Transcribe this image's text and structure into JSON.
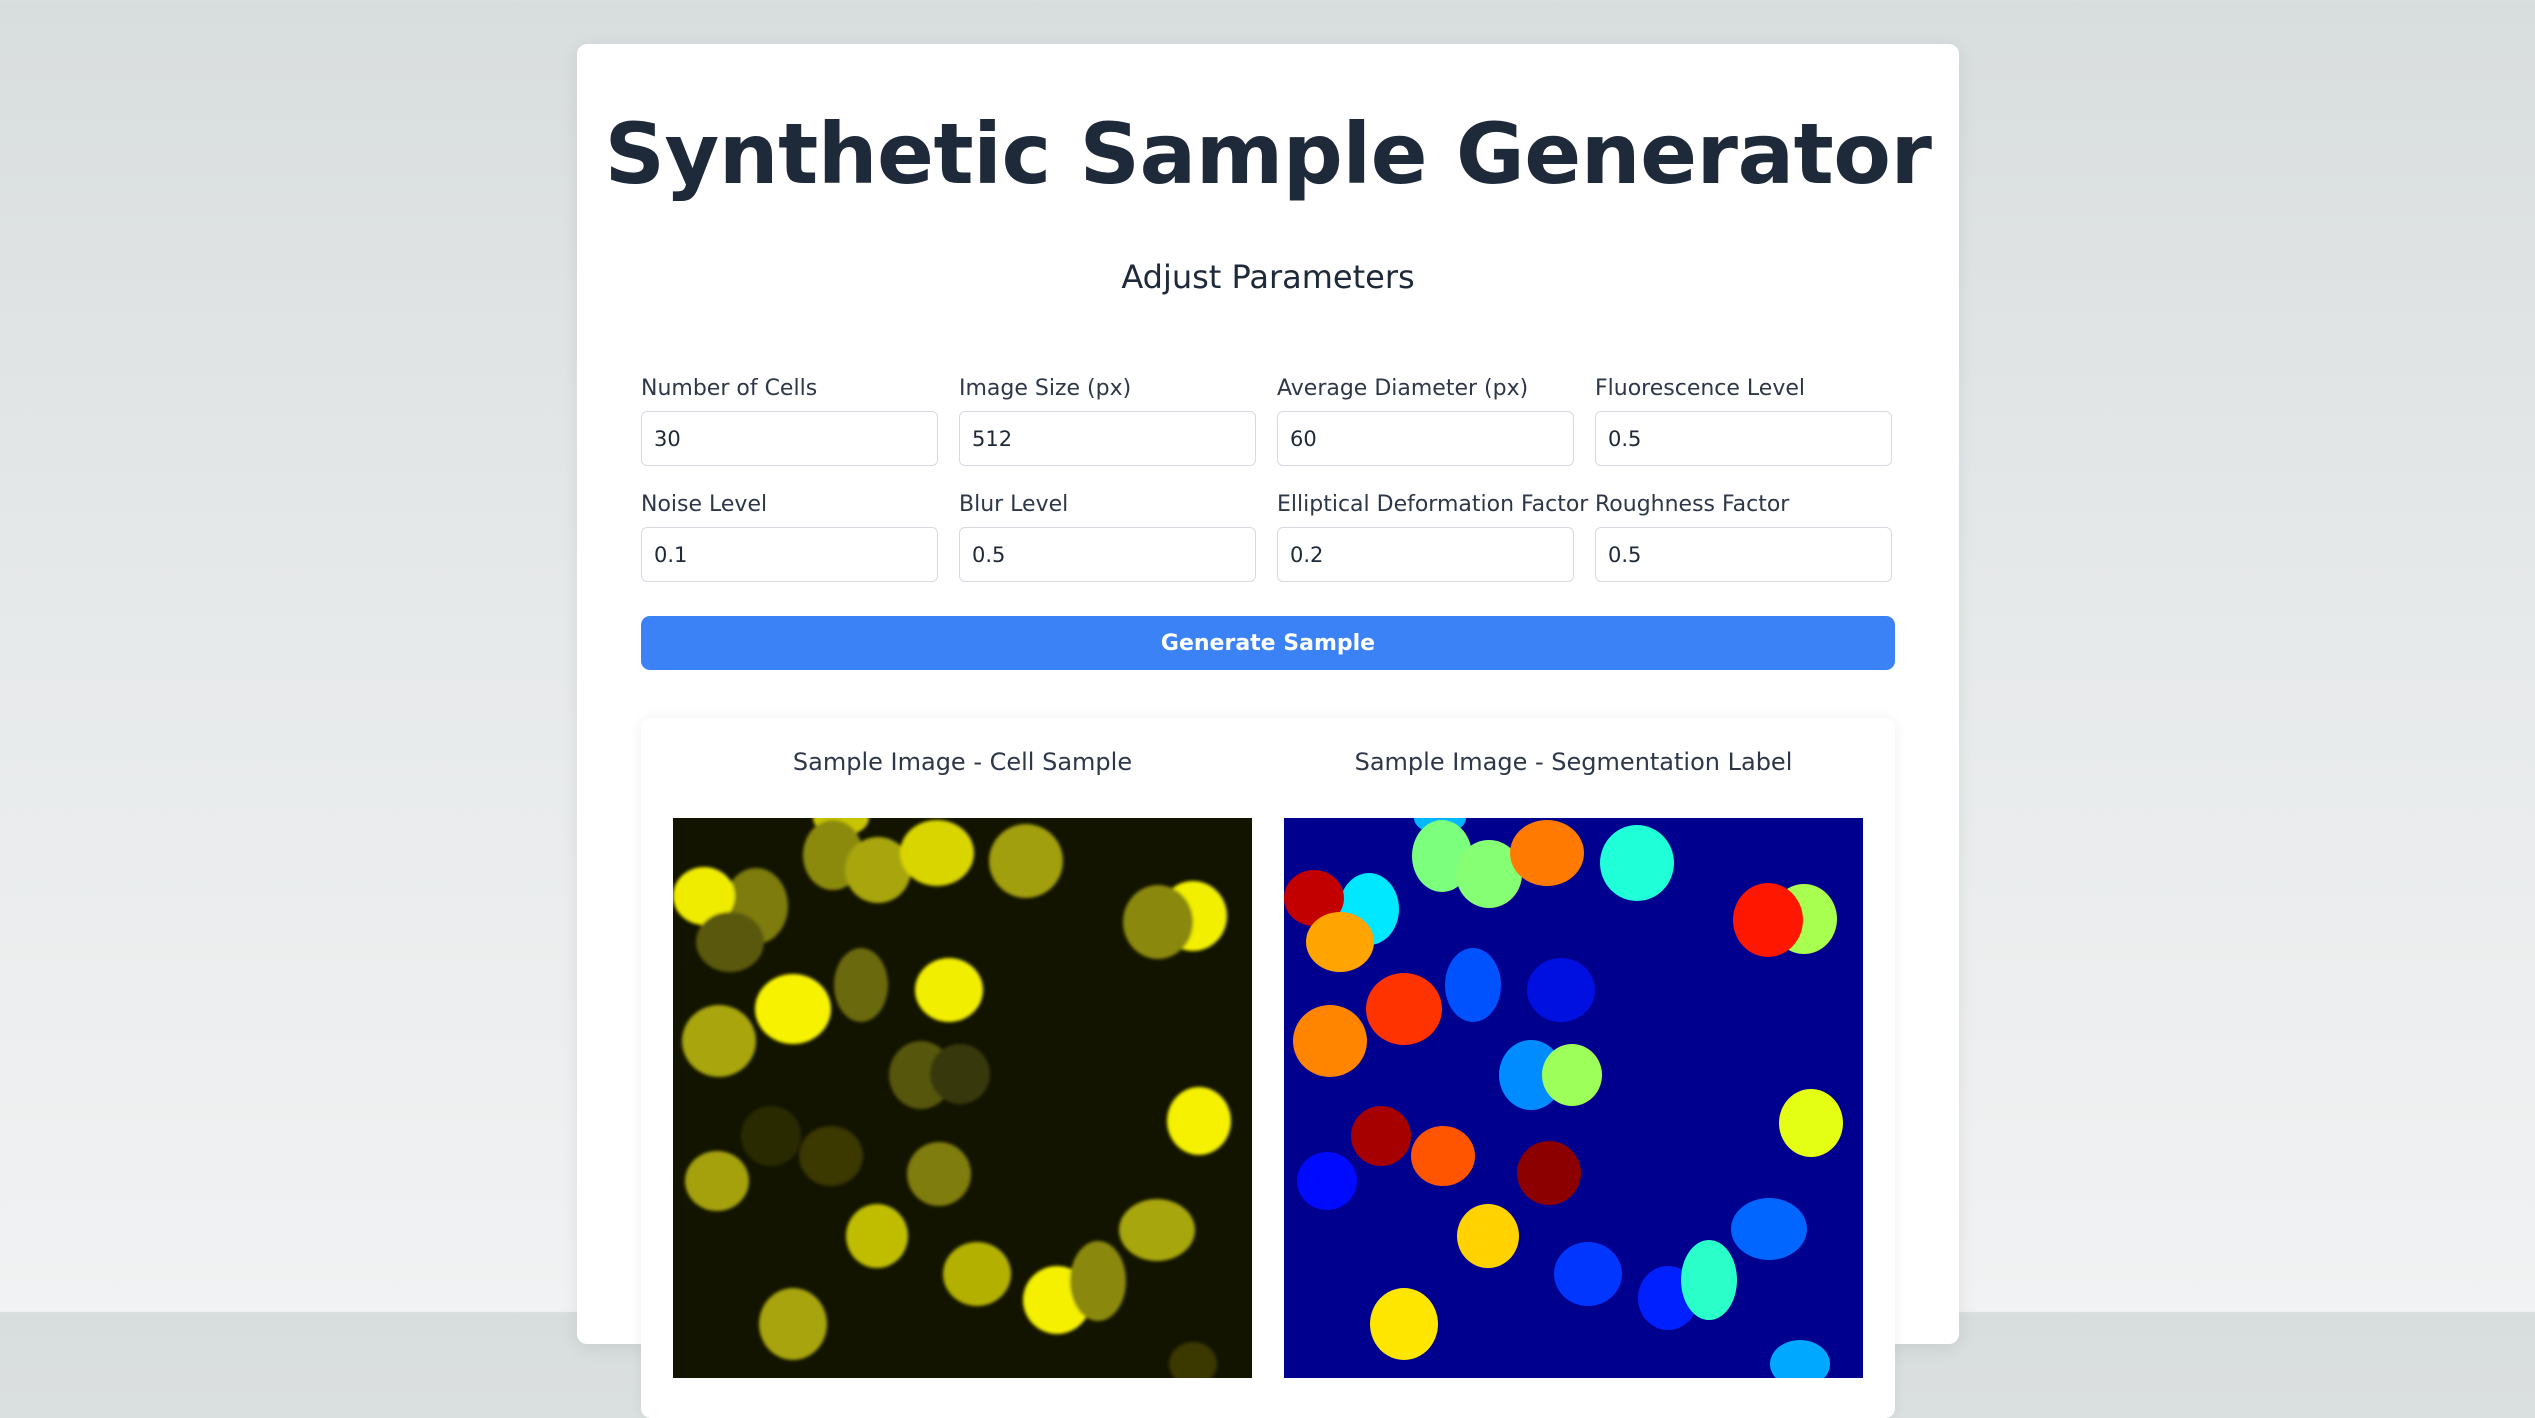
{
  "header": {
    "title": "Synthetic Sample Generator"
  },
  "params": {
    "section_title": "Adjust Parameters",
    "fields": [
      {
        "label": "Number of Cells",
        "value": "30"
      },
      {
        "label": "Image Size (px)",
        "value": "512"
      },
      {
        "label": "Average Diameter (px)",
        "value": "60"
      },
      {
        "label": "Fluorescence Level",
        "value": "0.5"
      },
      {
        "label": "Noise Level",
        "value": "0.1"
      },
      {
        "label": "Blur Level",
        "value": "0.5"
      },
      {
        "label": "Elliptical Deformation Factor",
        "value": "0.2"
      },
      {
        "label": "Roughness Factor",
        "value": "0.5"
      }
    ]
  },
  "actions": {
    "generate_label": "Generate Sample"
  },
  "results": {
    "cell_sample_title": "Sample Image - Cell Sample",
    "segmentation_title": "Sample Image - Segmentation Label"
  },
  "colors": {
    "accent": "#3b82f6",
    "cell_background": "#121400",
    "label_background": "#00008f"
  }
}
